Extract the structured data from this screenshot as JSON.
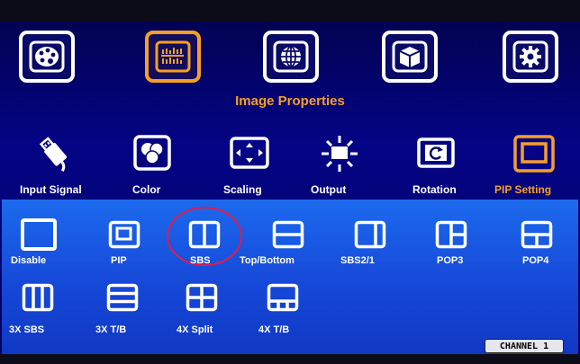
{
  "menu": {
    "top_icons": [
      {
        "name": "palette-icon",
        "active": false
      },
      {
        "name": "image-properties-icon",
        "active": true
      },
      {
        "name": "globe-icon",
        "active": false
      },
      {
        "name": "3d-cube-icon",
        "active": false
      },
      {
        "name": "settings-gear-icon",
        "active": false
      }
    ],
    "section_title": "Image Properties"
  },
  "sub_menu": {
    "items": [
      {
        "label": "Input Signal",
        "icon": "usb-cable-icon",
        "active": false
      },
      {
        "label": "Color",
        "icon": "color-circles-icon",
        "active": false
      },
      {
        "label": "Scaling",
        "icon": "scaling-arrows-icon",
        "active": false
      },
      {
        "label": "Output",
        "icon": "output-burst-icon",
        "active": false
      },
      {
        "label": "Rotation",
        "icon": "rotation-icon",
        "active": false
      },
      {
        "label": "PIP Setting",
        "icon": "pip-setting-icon",
        "active": true
      }
    ]
  },
  "pip_modes": {
    "row1": [
      {
        "label": "Disable",
        "icon": "disable-layout-icon",
        "selected": false
      },
      {
        "label": "PIP",
        "icon": "pip-layout-icon",
        "selected": false
      },
      {
        "label": "SBS",
        "icon": "sbs-layout-icon",
        "selected": true
      },
      {
        "label": "Top/Bottom",
        "icon": "top-bottom-layout-icon",
        "selected": false
      },
      {
        "label": "SBS2/1",
        "icon": "sbs2-1-layout-icon",
        "selected": false
      },
      {
        "label": "POP3",
        "icon": "pop3-layout-icon",
        "selected": false
      },
      {
        "label": "POP4",
        "icon": "pop4-layout-icon",
        "selected": false
      }
    ],
    "row2": [
      {
        "label": "3X SBS",
        "icon": "3x-sbs-layout-icon",
        "selected": false
      },
      {
        "label": "3X T/B",
        "icon": "3x-tb-layout-icon",
        "selected": false
      },
      {
        "label": "4X Split",
        "icon": "4x-split-layout-icon",
        "selected": false
      },
      {
        "label": "4X T/B",
        "icon": "4x-tb-layout-icon",
        "selected": false
      }
    ]
  },
  "status": {
    "channel": "CHANNEL 1"
  },
  "colors": {
    "accent": "#f59e2a",
    "highlight": "#e01c4a",
    "panel": "#1c6aee"
  }
}
